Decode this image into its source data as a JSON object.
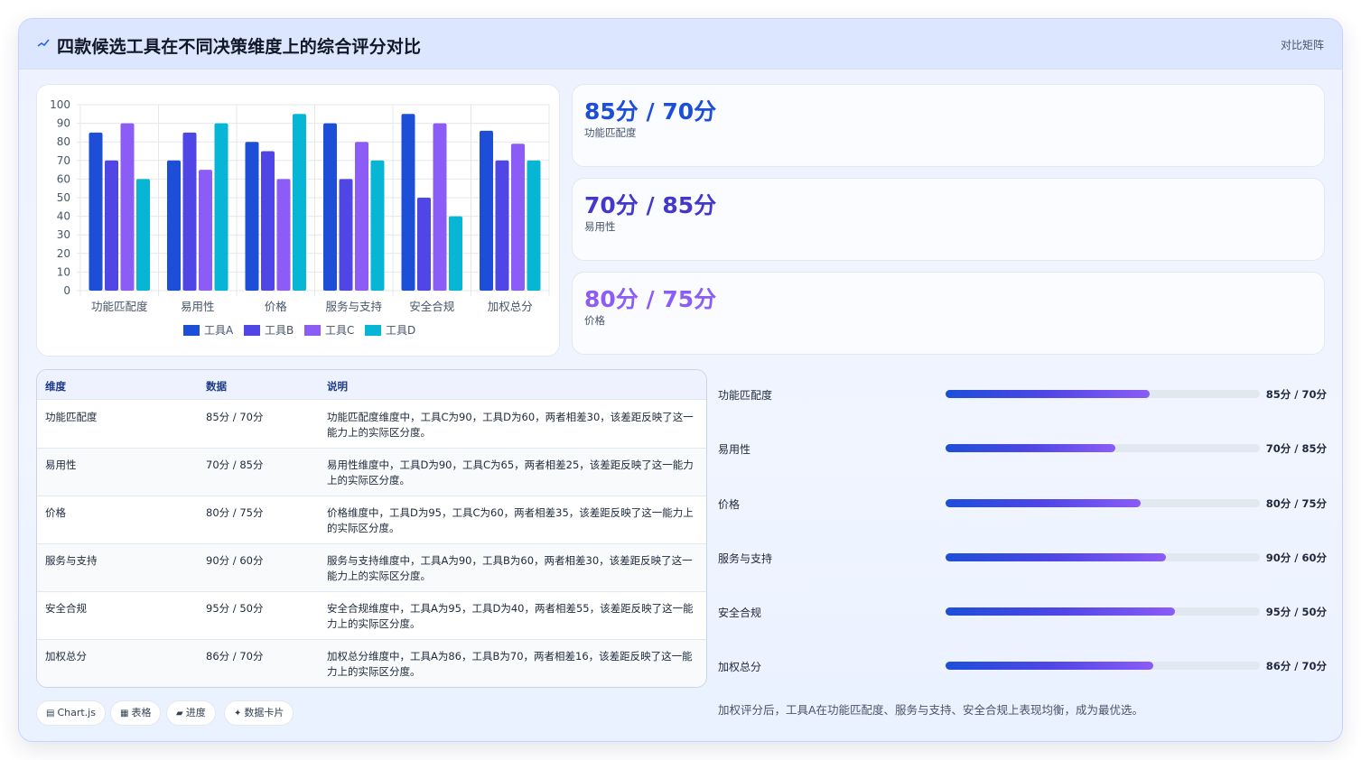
{
  "header": {
    "title": "四款候选工具在不同决策维度上的综合评分对比",
    "tag": "对比矩阵"
  },
  "chart_data": {
    "type": "bar",
    "categories": [
      "功能匹配度",
      "易用性",
      "价格",
      "服务与支持",
      "安全合规",
      "加权总分"
    ],
    "series": [
      {
        "name": "工具A",
        "color": "#1d4ed8",
        "values": [
          85,
          70,
          80,
          90,
          95,
          86
        ]
      },
      {
        "name": "工具B",
        "color": "#4f46e5",
        "values": [
          70,
          85,
          75,
          60,
          50,
          70
        ]
      },
      {
        "name": "工具C",
        "color": "#8b5cf6",
        "values": [
          90,
          65,
          60,
          80,
          90,
          79
        ]
      },
      {
        "name": "工具D",
        "color": "#06b6d4",
        "values": [
          60,
          90,
          95,
          70,
          40,
          70
        ]
      }
    ],
    "ylim": [
      0,
      100
    ],
    "yticks": [
      0,
      10,
      20,
      30,
      40,
      50,
      60,
      70,
      80,
      90,
      100
    ],
    "grid": true,
    "legend": "bottom"
  },
  "stat_cards": [
    {
      "value": "85分 / 70分",
      "label": "功能匹配度",
      "color": "#1d4ed8"
    },
    {
      "value": "70分 / 85分",
      "label": "易用性",
      "color": "#4338ca"
    },
    {
      "value": "80分 / 75分",
      "label": "价格",
      "color": "#8b5cf6"
    }
  ],
  "table": {
    "headers": [
      "维度",
      "数据",
      "说明"
    ],
    "rows": [
      {
        "dim": "功能匹配度",
        "data": "85分 / 70分",
        "desc": "功能匹配度维度中，工具C为90，工具D为60，两者相差30，该差距反映了这一能力上的实际区分度。"
      },
      {
        "dim": "易用性",
        "data": "70分 / 85分",
        "desc": "易用性维度中，工具D为90，工具C为65，两者相差25，该差距反映了这一能力上的实际区分度。"
      },
      {
        "dim": "价格",
        "data": "80分 / 75分",
        "desc": "价格维度中，工具D为95，工具C为60，两者相差35，该差距反映了这一能力上的实际区分度。"
      },
      {
        "dim": "服务与支持",
        "data": "90分 / 60分",
        "desc": "服务与支持维度中，工具A为90，工具B为60，两者相差30，该差距反映了这一能力上的实际区分度。"
      },
      {
        "dim": "安全合规",
        "data": "95分 / 50分",
        "desc": "安全合规维度中，工具A为95，工具D为40，两者相差55，该差距反映了这一能力上的实际区分度。"
      },
      {
        "dim": "加权总分",
        "data": "86分 / 70分",
        "desc": "加权总分维度中，工具A为86，工具B为70，两者相差16，该差距反映了这一能力上的实际区分度。"
      }
    ]
  },
  "progress": [
    {
      "label": "功能匹配度",
      "value": "85分 / 70分",
      "fraction": 0.65
    },
    {
      "label": "易用性",
      "value": "70分 / 85分",
      "fraction": 0.54
    },
    {
      "label": "价格",
      "value": "80分 / 75分",
      "fraction": 0.62
    },
    {
      "label": "服务与支持",
      "value": "90分 / 60分",
      "fraction": 0.7
    },
    {
      "label": "安全合规",
      "value": "95分 / 50分",
      "fraction": 0.73
    },
    {
      "label": "加权总分",
      "value": "86分 / 70分",
      "fraction": 0.66
    }
  ],
  "chips": [
    {
      "icon": "chart-icon",
      "glyph": "▤",
      "label": "Chart.js"
    },
    {
      "icon": "table-icon",
      "glyph": "▦",
      "label": "表格"
    },
    {
      "icon": "progress-icon",
      "glyph": "▰",
      "label": "进度"
    },
    {
      "icon": "card-icon",
      "glyph": "✦",
      "label": "数据卡片"
    }
  ],
  "summary": "加权评分后，工具A在功能匹配度、服务与支持、安全合规上表现均衡，成为最优选。"
}
